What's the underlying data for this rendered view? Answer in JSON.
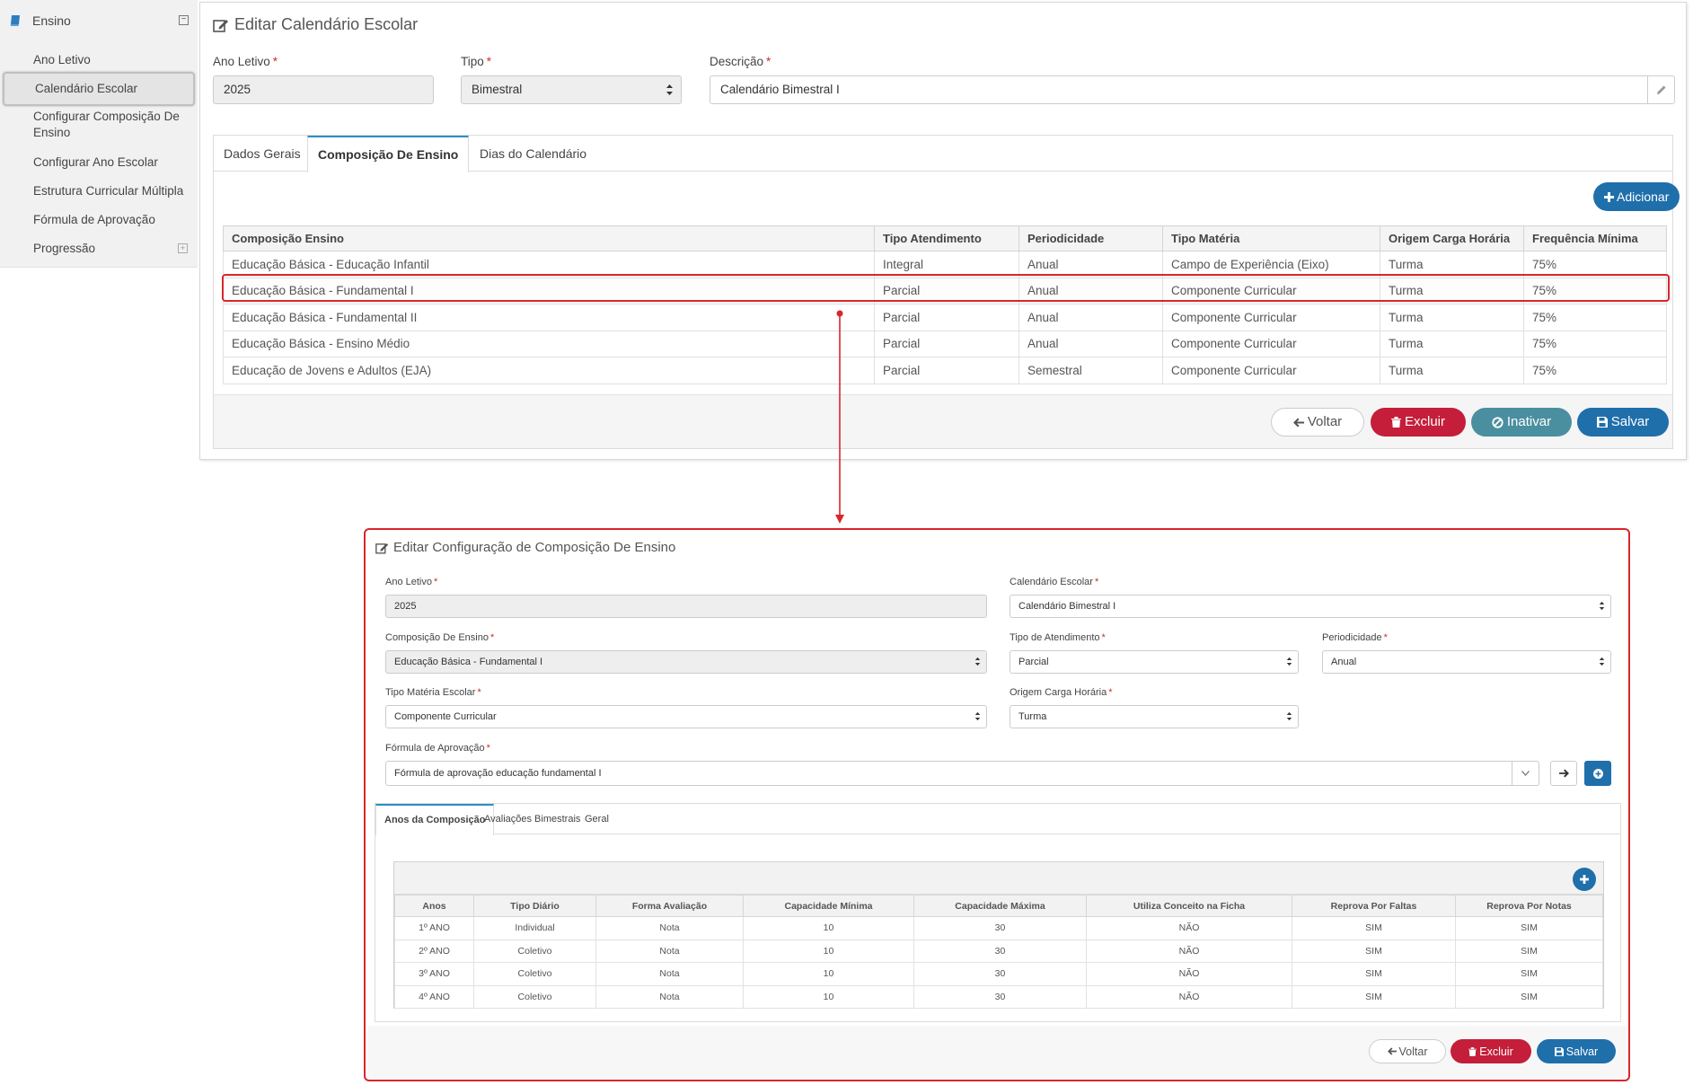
{
  "sidebar": {
    "section_title": "Ensino",
    "items": [
      {
        "label": "Ano Letivo"
      },
      {
        "label": "Calendário Escolar"
      },
      {
        "label": "Configurar Composição De Ensino"
      },
      {
        "label": "Configurar Ano Escolar"
      },
      {
        "label": "Estrutura Curricular Múltipla"
      },
      {
        "label": "Fórmula de Aprovação"
      },
      {
        "label": "Progressão"
      }
    ]
  },
  "calendar_form": {
    "title": "Editar Calendário Escolar",
    "ano_letivo": {
      "label": "Ano Letivo",
      "value": "2025"
    },
    "tipo": {
      "label": "Tipo",
      "value": "Bimestral"
    },
    "descricao": {
      "label": "Descrição",
      "value": "Calendário Bimestral I"
    },
    "tabs": [
      {
        "label": "Dados Gerais"
      },
      {
        "label": "Composição De Ensino"
      },
      {
        "label": "Dias do Calendário"
      }
    ],
    "add_button": "Adicionar",
    "table": {
      "headers": [
        "Composição Ensino",
        "Tipo Atendimento",
        "Periodicidade",
        "Tipo Matéria",
        "Origem Carga Horária",
        "Frequência Mínima"
      ],
      "rows": [
        [
          "Educação Básica - Educação Infantil",
          "Integral",
          "Anual",
          "Campo de Experiência (Eixo)",
          "Turma",
          "75%"
        ],
        [
          "Educação Básica - Fundamental I",
          "Parcial",
          "Anual",
          "Componente Curricular",
          "Turma",
          "75%"
        ],
        [
          "Educação Básica - Fundamental II",
          "Parcial",
          "Anual",
          "Componente Curricular",
          "Turma",
          "75%"
        ],
        [
          "Educação Básica - Ensino Médio",
          "Parcial",
          "Anual",
          "Componente Curricular",
          "Turma",
          "75%"
        ],
        [
          "Educação de Jovens e Adultos (EJA)",
          "Parcial",
          "Semestral",
          "Componente Curricular",
          "Turma",
          "75%"
        ]
      ]
    },
    "buttons": {
      "back": "Voltar",
      "delete": "Excluir",
      "inactivate": "Inativar",
      "save": "Salvar"
    }
  },
  "composition_form": {
    "title": "Editar Configuração de Composição De Ensino",
    "ano_letivo": {
      "label": "Ano Letivo",
      "value": "2025"
    },
    "calendario": {
      "label": "Calendário Escolar",
      "value": "Calendário Bimestral I"
    },
    "composicao": {
      "label": "Composição De Ensino",
      "value": "Educação Básica - Fundamental I"
    },
    "tipo_atendimento": {
      "label": "Tipo de Atendimento",
      "value": "Parcial"
    },
    "periodicidade": {
      "label": "Periodicidade",
      "value": "Anual"
    },
    "tipo_materia": {
      "label": "Tipo Matéria Escolar",
      "value": "Componente Curricular"
    },
    "origem_carga": {
      "label": "Origem Carga Horária",
      "value": "Turma"
    },
    "formula": {
      "label": "Fórmula de Aprovação",
      "value": "Fórmula de aprovação educação fundamental I"
    },
    "tabs": [
      {
        "label": "Anos da Composição"
      },
      {
        "label": "Avaliações Bimestrais"
      },
      {
        "label": "Geral"
      }
    ],
    "table": {
      "headers": [
        "Anos",
        "Tipo Diário",
        "Forma Avaliação",
        "Capacidade Mínima",
        "Capacidade Máxima",
        "Utiliza Conceito na Ficha",
        "Reprova Por Faltas",
        "Reprova Por Notas"
      ],
      "rows": [
        [
          "1º ANO",
          "Individual",
          "Nota",
          "10",
          "30",
          "NÃO",
          "SIM",
          "SIM"
        ],
        [
          "2º ANO",
          "Coletivo",
          "Nota",
          "10",
          "30",
          "NÃO",
          "SIM",
          "SIM"
        ],
        [
          "3º ANO",
          "Coletivo",
          "Nota",
          "10",
          "30",
          "NÃO",
          "SIM",
          "SIM"
        ],
        [
          "4º ANO",
          "Coletivo",
          "Nota",
          "10",
          "30",
          "NÃO",
          "SIM",
          "SIM"
        ]
      ]
    },
    "buttons": {
      "back": "Voltar",
      "delete": "Excluir",
      "save": "Salvar"
    }
  },
  "colors": {
    "primary": "#1f6fab",
    "danger": "#c41e3a",
    "inactive": "#4a8fa0",
    "highlight": "#d9262b"
  }
}
